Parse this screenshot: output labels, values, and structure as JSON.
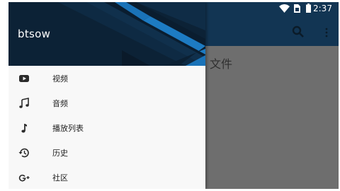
{
  "status_bar": {
    "time": "2:37"
  },
  "drawer": {
    "app_name": "btsow",
    "items": [
      {
        "label": "视频",
        "icon": "youtube-icon"
      },
      {
        "label": "音频",
        "icon": "music-notes-icon"
      },
      {
        "label": "播放列表",
        "icon": "music-note-icon"
      },
      {
        "label": "历史",
        "icon": "history-icon"
      },
      {
        "label": "社区",
        "icon": "google-plus-icon"
      }
    ]
  },
  "background": {
    "partial_title": "文件"
  },
  "colors": {
    "toolbar": "#123553",
    "drawer_header": "#0c2236",
    "accent_stripe": "#1a73b8",
    "scrim": "#6f6f6f",
    "drawer_bg": "#f8f8f8"
  }
}
